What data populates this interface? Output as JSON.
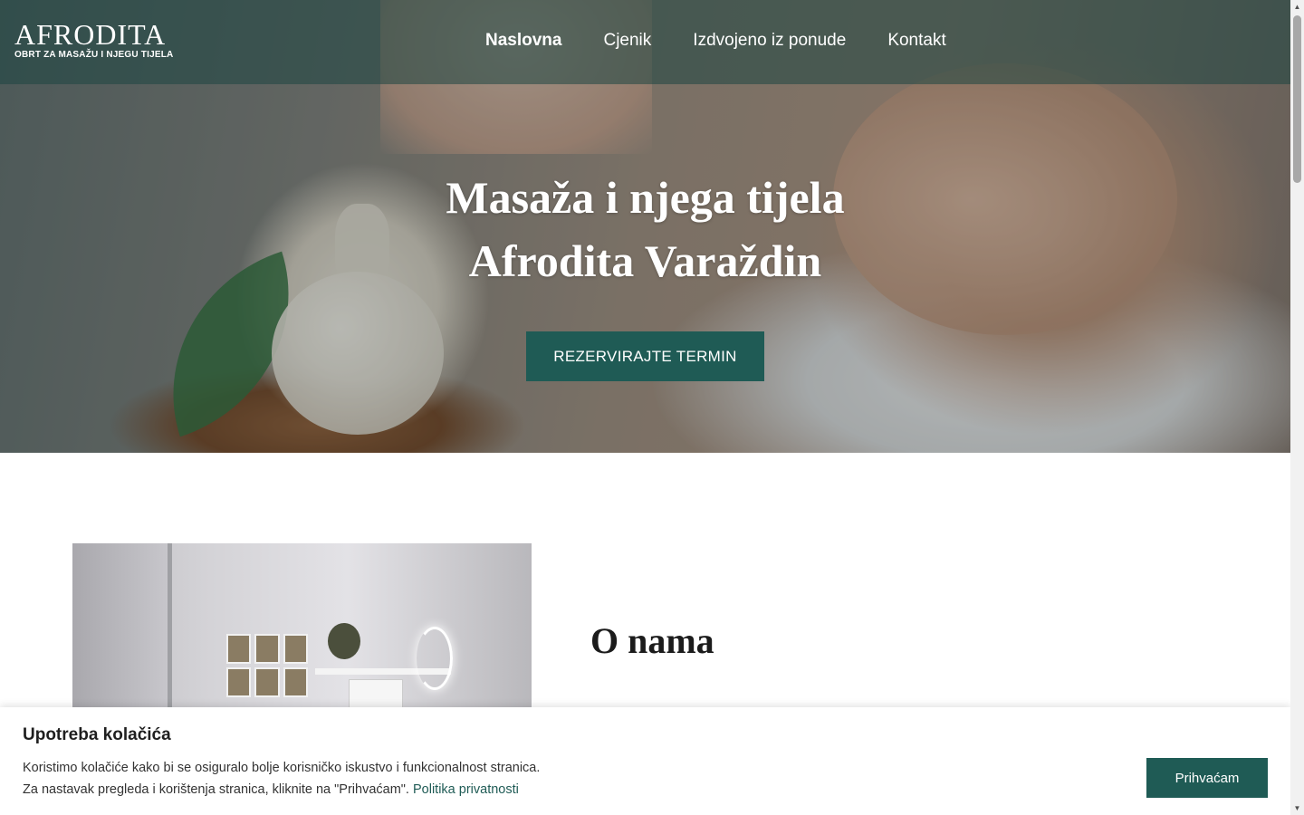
{
  "brand": {
    "name": "AFRODITA",
    "tagline": "OBRT ZA MASAŽU I NJEGU TIJELA"
  },
  "nav": {
    "items": [
      {
        "label": "Naslovna",
        "active": true
      },
      {
        "label": "Cjenik",
        "active": false
      },
      {
        "label": "Izdvojeno iz ponude",
        "active": false
      },
      {
        "label": "Kontakt",
        "active": false
      }
    ]
  },
  "hero": {
    "title_line1": "Masaža i njega tijela",
    "title_line2": "Afrodita Varaždin",
    "cta_label": "REZERVIRAJTE TERMIN"
  },
  "about": {
    "title": "O nama"
  },
  "cookie_banner": {
    "title": "Upotreba kolačića",
    "text_line1": "Koristimo kolačiće kako bi se osiguralo bolje korisničko iskustvo i funkcionalnost stranica.",
    "text_line2": "Za nastavak pregleda i korištenja stranica, kliknite na \"Prihvaćam\".",
    "privacy_link": "Politika privatnosti",
    "accept_label": "Prihvaćam"
  },
  "colors": {
    "accent": "#1f5b55",
    "header_overlay": "#1e4641",
    "text_dark": "#1b1b1b"
  },
  "icons": {
    "scroll_up": "triangle-up-icon",
    "scroll_down": "triangle-down-icon"
  }
}
